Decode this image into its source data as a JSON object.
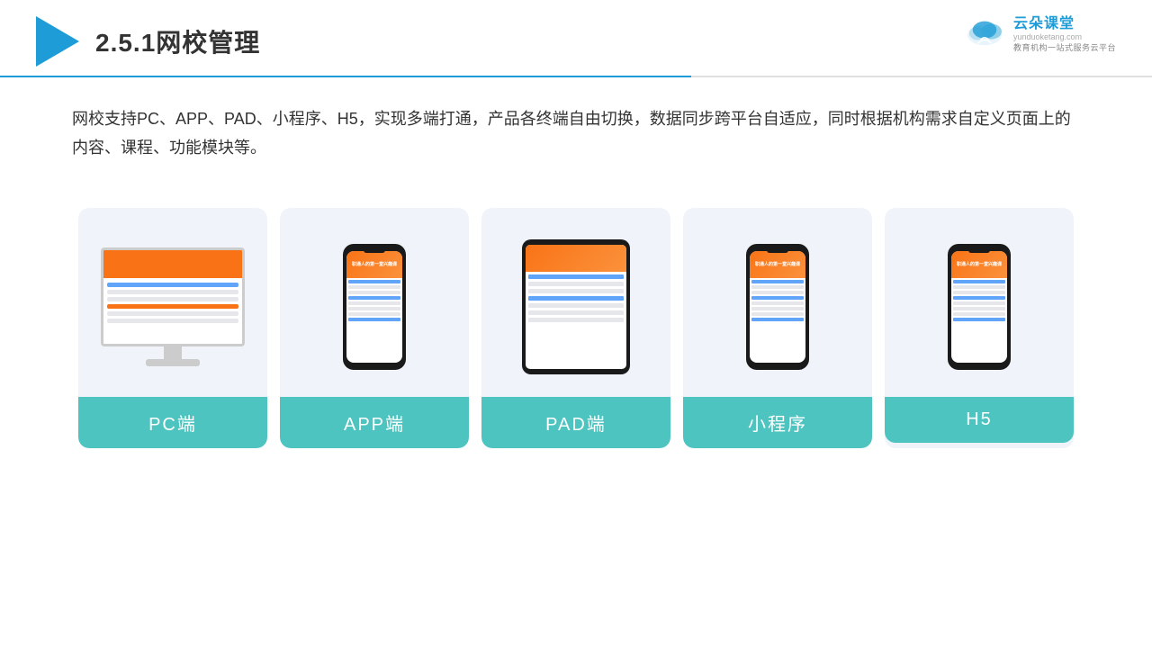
{
  "header": {
    "title": "2.5.1网校管理",
    "title_number": "2.5.1",
    "title_text": "网校管理"
  },
  "brand": {
    "name": "云朵课堂",
    "sub": "教育机构一站式服务云平台",
    "url": "yunduoketang.com"
  },
  "description": {
    "text": "网校支持PC、APP、PAD、小程序、H5，实现多端打通，产品各终端自由切换，数据同步跨平台自适应，同时根据机构需求自定义页面上的内容、课程、功能模块等。"
  },
  "cards": [
    {
      "id": "pc",
      "label": "PC端"
    },
    {
      "id": "app",
      "label": "APP端"
    },
    {
      "id": "pad",
      "label": "PAD端"
    },
    {
      "id": "miniapp",
      "label": "小程序"
    },
    {
      "id": "h5",
      "label": "H5"
    }
  ],
  "colors": {
    "accent": "#1e9cd7",
    "card_bg": "#eef2f8",
    "label_bg": "#4dc4c0"
  }
}
